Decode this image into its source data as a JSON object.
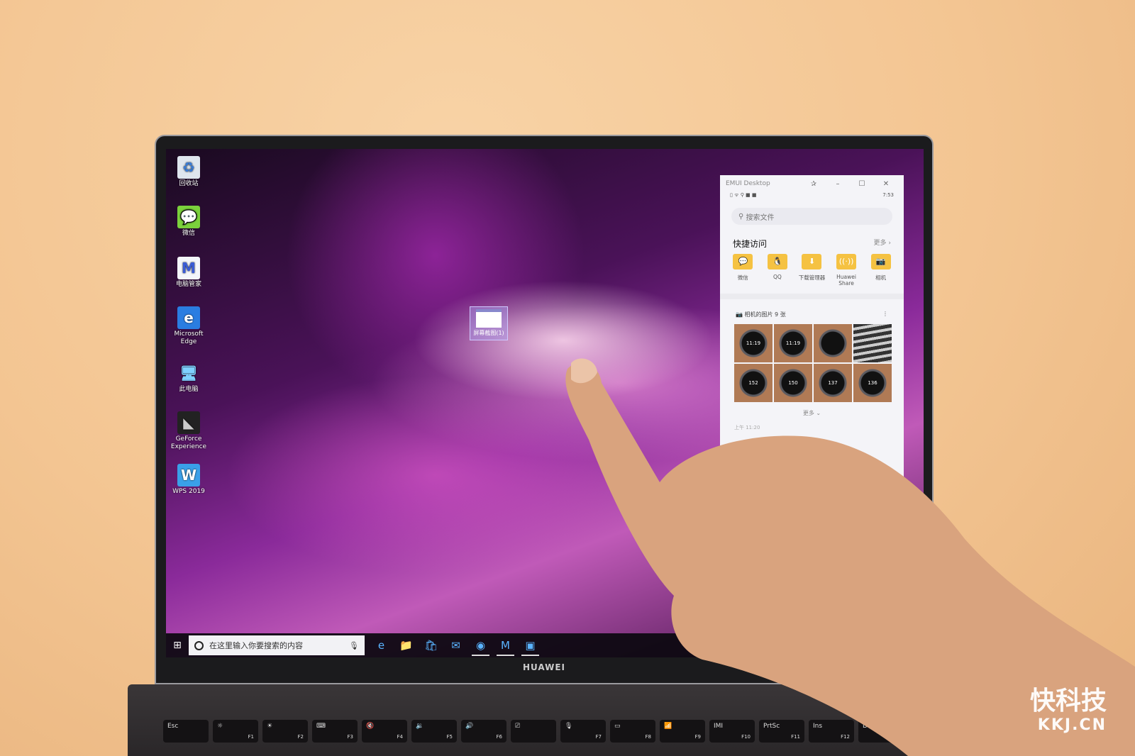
{
  "desktop": {
    "icons": [
      {
        "label": "回收站",
        "icon": "recycle-bin-icon",
        "glyph": "♻",
        "bg": "#dfe6ee",
        "fg": "#3a7bd5"
      },
      {
        "label": "微信",
        "icon": "wechat-icon",
        "glyph": "💬",
        "bg": "#7bd13c",
        "fg": "#fff"
      },
      {
        "label": "电脑管家",
        "icon": "pc-manager-icon",
        "glyph": "M",
        "bg": "#f4f6fb",
        "fg": "#3a5bd5"
      },
      {
        "label": "Microsoft Edge",
        "icon": "edge-icon",
        "glyph": "e",
        "bg": "#2a7de1",
        "fg": "#fff"
      },
      {
        "label": "此电脑",
        "icon": "this-pc-icon",
        "glyph": "🖥",
        "bg": "transparent",
        "fg": "#7fd0ff"
      },
      {
        "label": "GeForce Experience",
        "icon": "geforce-icon",
        "glyph": "◣",
        "bg": "#222",
        "fg": "#ccc"
      },
      {
        "label": "WPS 2019",
        "icon": "wps-icon",
        "glyph": "W",
        "bg": "#3aa0e8",
        "fg": "#fff"
      }
    ],
    "dragged_file": "屏幕截图(1)"
  },
  "taskbar": {
    "search_placeholder": "在这里输入你要搜索的内容",
    "apps": [
      {
        "icon": "edge-icon",
        "glyph": "e"
      },
      {
        "icon": "file-explorer-icon",
        "glyph": "📁"
      },
      {
        "icon": "store-icon",
        "glyph": "🛍"
      },
      {
        "icon": "mail-icon",
        "glyph": "✉"
      },
      {
        "icon": "chrome-icon",
        "glyph": "◉",
        "running": true
      },
      {
        "icon": "pc-manager-icon",
        "glyph": "M",
        "running": true
      },
      {
        "icon": "emui-desktop-icon",
        "glyph": "▣",
        "running": true
      }
    ]
  },
  "brand": "HUAWEI",
  "panel": {
    "title": "EMUI Desktop",
    "status_time": "7:53",
    "search_placeholder": "搜索文件",
    "quick_title": "快捷访问",
    "quick_more": "更多 ›",
    "quick": [
      {
        "label": "微信",
        "glyph": "💬"
      },
      {
        "label": "QQ",
        "glyph": "🐧"
      },
      {
        "label": "下载管理器",
        "glyph": "⬇"
      },
      {
        "label": "Huawei Share",
        "glyph": "((·))"
      },
      {
        "label": "相机",
        "glyph": "📷"
      }
    ],
    "photos_title": "相机的图片 9 张",
    "photos": [
      "11:19",
      "11:19",
      "",
      "",
      "152",
      "150",
      "137",
      "136"
    ],
    "more": "更多 ⌄",
    "time": "上午 11:20"
  },
  "keyboard": {
    "keys": [
      {
        "k": "Esc",
        "f": ""
      },
      {
        "k": "☼",
        "f": "F1"
      },
      {
        "k": "☀",
        "f": "F2"
      },
      {
        "k": "⌨",
        "f": "F3"
      },
      {
        "k": "🔇",
        "f": "F4"
      },
      {
        "k": "🔉",
        "f": "F5"
      },
      {
        "k": "🔊",
        "f": "F6"
      },
      {
        "k": "⎚",
        "f": ""
      },
      {
        "k": "🎙",
        "f": "F7"
      },
      {
        "k": "▭",
        "f": "F8"
      },
      {
        "k": "📶",
        "f": "F9"
      },
      {
        "k": "IMI",
        "f": "F10"
      },
      {
        "k": "PrtSc",
        "f": "F11"
      },
      {
        "k": "Ins",
        "f": "F12"
      },
      {
        "k": "Del",
        "f": ""
      }
    ]
  },
  "watermark": {
    "cn": "快科技",
    "en": "KKJ.CN"
  }
}
